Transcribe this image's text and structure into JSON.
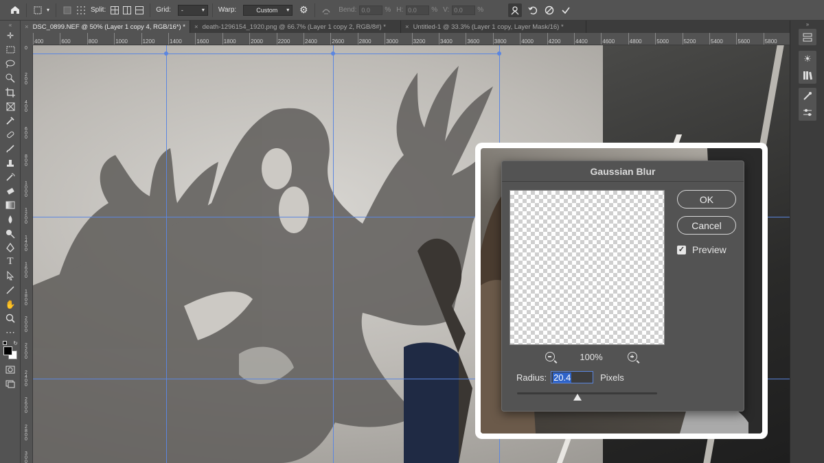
{
  "optionsbar": {
    "split_label": "Split:",
    "grid_label": "Grid:",
    "grid_value": "-",
    "warp_label": "Warp:",
    "warp_value": "Custom",
    "bend_label": "Bend:",
    "bend_value": "0.0",
    "h_label": "H:",
    "h_value": "0.0",
    "v_label": "V:",
    "v_value": "0.0",
    "pct": "%"
  },
  "tabs": [
    {
      "label": "DSC_0899.NEF @ 50% (Layer 1 copy 4, RGB/16*) *",
      "active": true
    },
    {
      "label": "death-1296154_1920.png @ 66.7% (Layer 1 copy 2, RGB/8#) *",
      "active": false
    },
    {
      "label": "Untitled-1 @ 33.3% (Layer 1 copy, Layer Mask/16) *",
      "active": false
    }
  ],
  "ruler_top": [
    "400",
    "600",
    "800",
    "1000",
    "1200",
    "1400",
    "1600",
    "1800",
    "2000",
    "2200",
    "2400",
    "2600",
    "2800",
    "3000",
    "3200",
    "3400",
    "3600",
    "3800",
    "4000",
    "4200",
    "4400",
    "4600",
    "4800",
    "5000",
    "5200",
    "5400",
    "5600",
    "5800"
  ],
  "ruler_left": [
    "0",
    "200",
    "400",
    "600",
    "800",
    "1000",
    "1200",
    "1400",
    "1600",
    "1800",
    "2000",
    "2200",
    "2400",
    "2600",
    "2800",
    "3000"
  ],
  "dialog": {
    "title": "Gaussian Blur",
    "ok": "OK",
    "cancel": "Cancel",
    "preview_label": "Preview",
    "preview_checked": true,
    "zoom": "100%",
    "radius_label": "Radius:",
    "radius_value": "20.4",
    "units": "Pixels",
    "slider_fraction": 0.43
  },
  "colors": {
    "accent": "#5b86e0",
    "ui_dark": "#535353",
    "ui_darker": "#3c3c3c"
  }
}
